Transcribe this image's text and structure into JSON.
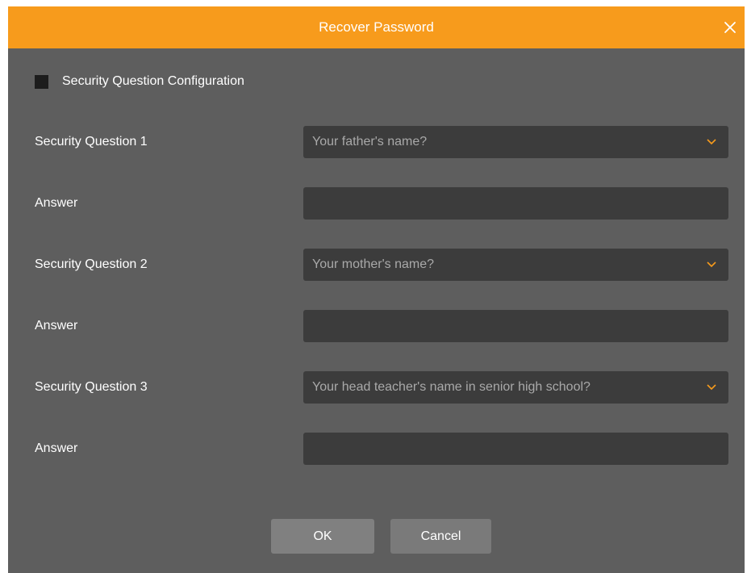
{
  "dialog": {
    "title": "Recover Password",
    "close_icon": "close-icon",
    "accent_color": "#f79b1c"
  },
  "config": {
    "label": "Security Question Configuration",
    "checked": false
  },
  "questions": [
    {
      "label": "Security Question 1",
      "selected": "Your father's name?",
      "answer_label": "Answer",
      "answer_value": ""
    },
    {
      "label": "Security Question 2",
      "selected": "Your mother's name?",
      "answer_label": "Answer",
      "answer_value": ""
    },
    {
      "label": "Security Question 3",
      "selected": "Your head teacher's name in senior high school?",
      "answer_label": "Answer",
      "answer_value": ""
    }
  ],
  "buttons": {
    "ok_label": "OK",
    "cancel_label": "Cancel"
  }
}
